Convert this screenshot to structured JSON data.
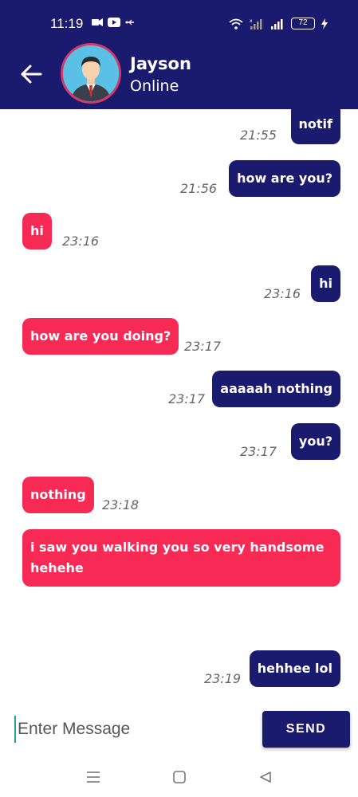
{
  "status_bar": {
    "time": "11:19",
    "battery": "72"
  },
  "header": {
    "contact_name": "Jayson",
    "contact_status": "Online"
  },
  "messages": [
    {
      "direction": "sent",
      "text": "notif",
      "time": "21:55"
    },
    {
      "direction": "sent",
      "text": "how are you?",
      "time": "21:56"
    },
    {
      "direction": "received",
      "text": "hi",
      "time": "23:16"
    },
    {
      "direction": "sent",
      "text": "hi",
      "time": "23:16"
    },
    {
      "direction": "received",
      "text": "how are you doing?",
      "time": "23:17"
    },
    {
      "direction": "sent",
      "text": "aaaaah nothing",
      "time": "23:17"
    },
    {
      "direction": "sent",
      "text": "you?",
      "time": "23:17"
    },
    {
      "direction": "received",
      "text": "nothing",
      "time": "23:18"
    },
    {
      "direction": "received",
      "text": "i saw you walking you so very handsome hehehe",
      "time": ""
    },
    {
      "direction": "sent",
      "text": "hehhee lol",
      "time": "23:19"
    }
  ],
  "input": {
    "placeholder": "Enter Message",
    "value": ""
  },
  "send_button": {
    "label": "SEND"
  },
  "colors": {
    "header": "#1a1a6e",
    "sent_bubble": "#1a1a6e",
    "received_bubble": "#f72a55",
    "time_text": "#666666"
  },
  "icons": {
    "back": "arrow-left-icon",
    "nav_recent": "menu-icon",
    "nav_home": "square-icon",
    "nav_back": "triangle-back-icon"
  }
}
